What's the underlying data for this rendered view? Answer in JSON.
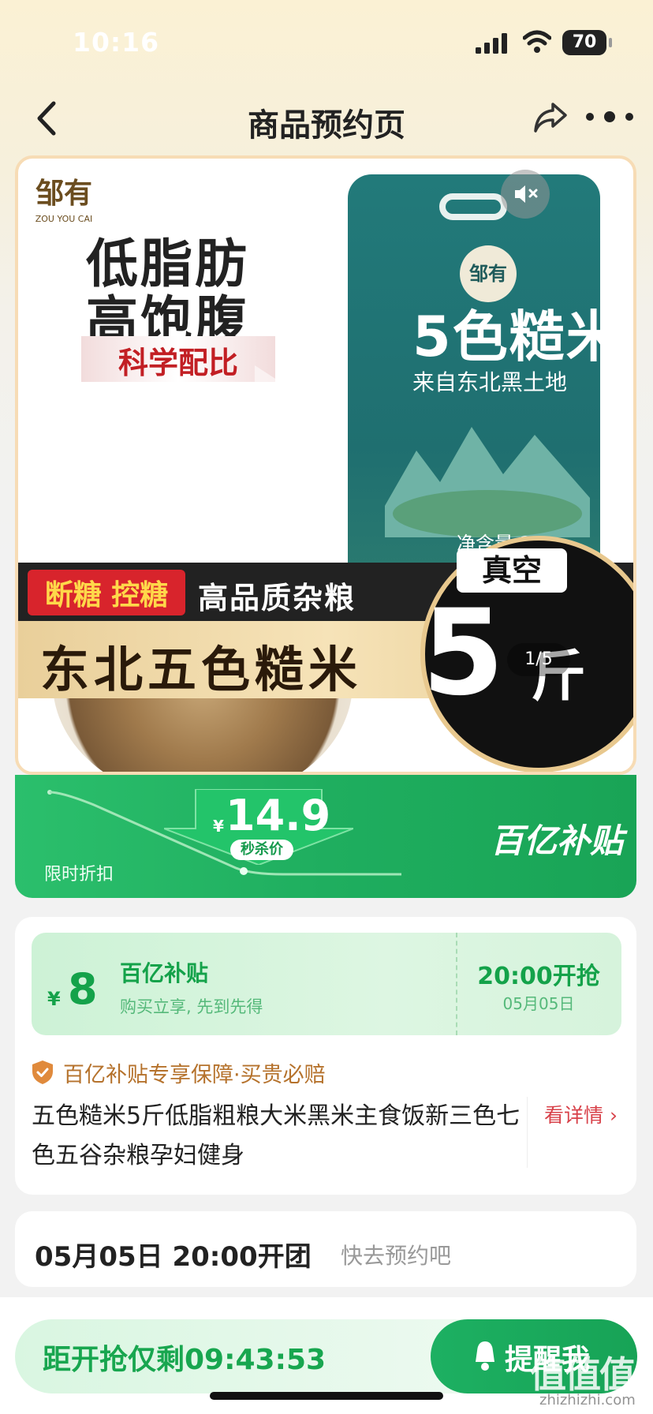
{
  "status_bar": {
    "time": "10:16",
    "battery": "70"
  },
  "nav": {
    "title": "商品预约页"
  },
  "hero": {
    "brand": "邹有",
    "brand_sub": "ZOU YOU CAI",
    "headline_1": "低脂肪",
    "headline_2": "高饱腹",
    "science_tag": "科学配比",
    "bag_title": "5色糙米",
    "bag_subtitle": "来自东北黑土地",
    "bag_logo": "邹有",
    "bag_net": "净含量:2.5",
    "red_tag": "断糖 控糖",
    "band_text": "高品质杂粮",
    "product_line": "东北五色糙米",
    "vacuum": "真空",
    "weight": "5",
    "unit": "斤",
    "pager": "1/5"
  },
  "price_bar": {
    "currency": "¥",
    "price": "14.9",
    "flash_label": "秒杀价",
    "limited": "限时折扣",
    "subsidy_brand": "百亿补贴"
  },
  "coupon": {
    "currency": "¥",
    "amount": "8",
    "title": "百亿补贴",
    "subtitle": "购买立享, 先到先得",
    "start_time": "20:00开抢",
    "date": "05月05日"
  },
  "guarantee": "百亿补贴专享保障·买贵必赔",
  "product_title": "五色糙米5斤低脂粗粮大米黑米主食饭新三色七色五谷杂粮孕妇健身",
  "detail_link": "看详情 ›",
  "group": {
    "main": "05月05日 20:00开团",
    "sub": "快去预约吧"
  },
  "bottom": {
    "countdown": "距开抢仅剩09:43:53",
    "remind": "提醒我"
  },
  "watermark": {
    "text": "值值值",
    "sub": "zhizhizhi.com"
  },
  "colors": {
    "accent_green": "#1fae5f",
    "red": "#d8242c",
    "gold": "#e9cf9a"
  }
}
